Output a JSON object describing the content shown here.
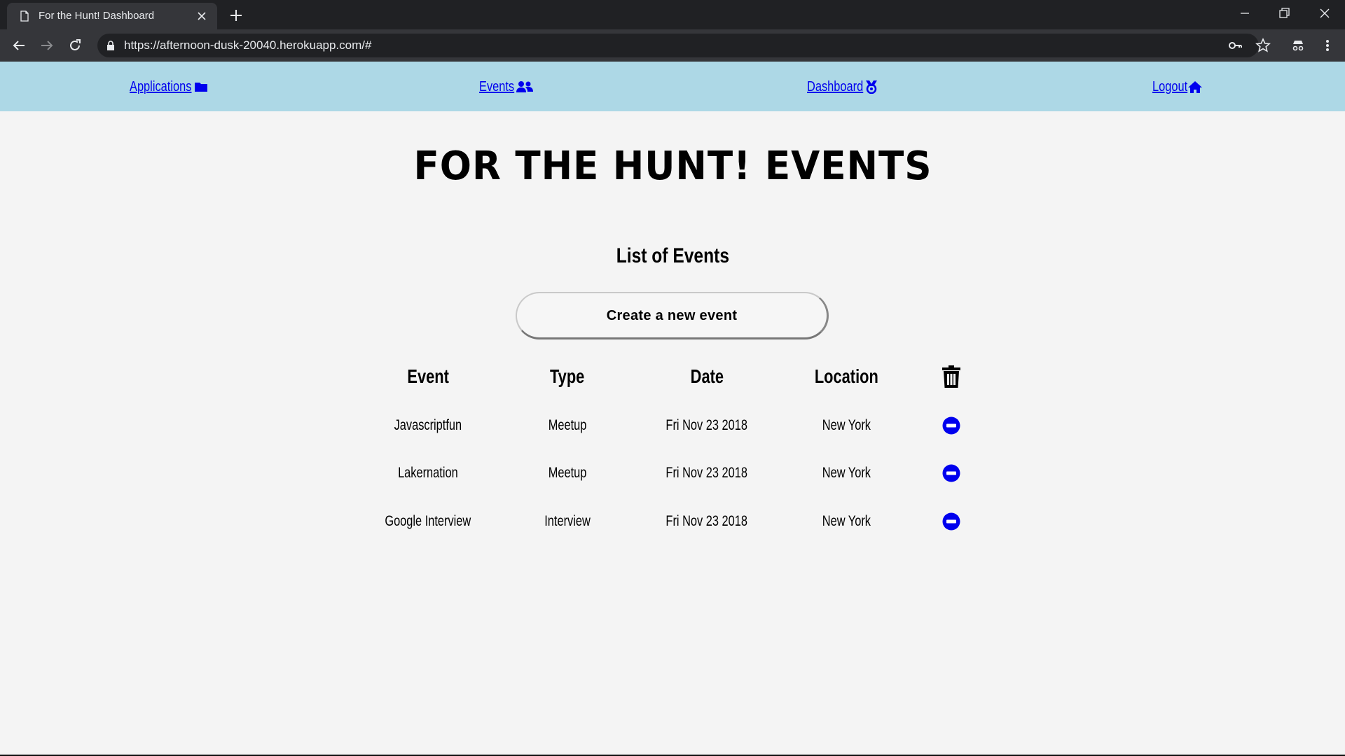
{
  "browser": {
    "tab_title": "For the Hunt! Dashboard",
    "url": "https://afternoon-dusk-20040.herokuapp.com/#"
  },
  "nav": {
    "applications": {
      "label": "Applications",
      "icon": "folder-icon"
    },
    "events": {
      "label": "Events",
      "icon": "users-icon"
    },
    "dashboard": {
      "label": "Dashboard",
      "icon": "medal-icon"
    },
    "logout": {
      "label": "Logout",
      "icon": "home-icon"
    }
  },
  "colors": {
    "nav_bg": "#add8e6",
    "link": "#0000ee",
    "page_bg": "#f4f4f4"
  },
  "main": {
    "brand_title": "FOR THE HUNT! EVENTS",
    "list_title": "List of Events",
    "create_button": "Create a new event",
    "columns": {
      "event": "Event",
      "type": "Type",
      "date": "Date",
      "location": "Location",
      "delete_icon": "trash-icon"
    },
    "rows": [
      {
        "event": "Javascriptfun",
        "type": "Meetup",
        "date": "Fri Nov 23 2018",
        "location": "New York"
      },
      {
        "event": "Lakernation",
        "type": "Meetup",
        "date": "Fri Nov 23 2018",
        "location": "New York"
      },
      {
        "event": "Google Interview",
        "type": "Interview",
        "date": "Fri Nov 23 2018",
        "location": "New York"
      }
    ]
  }
}
